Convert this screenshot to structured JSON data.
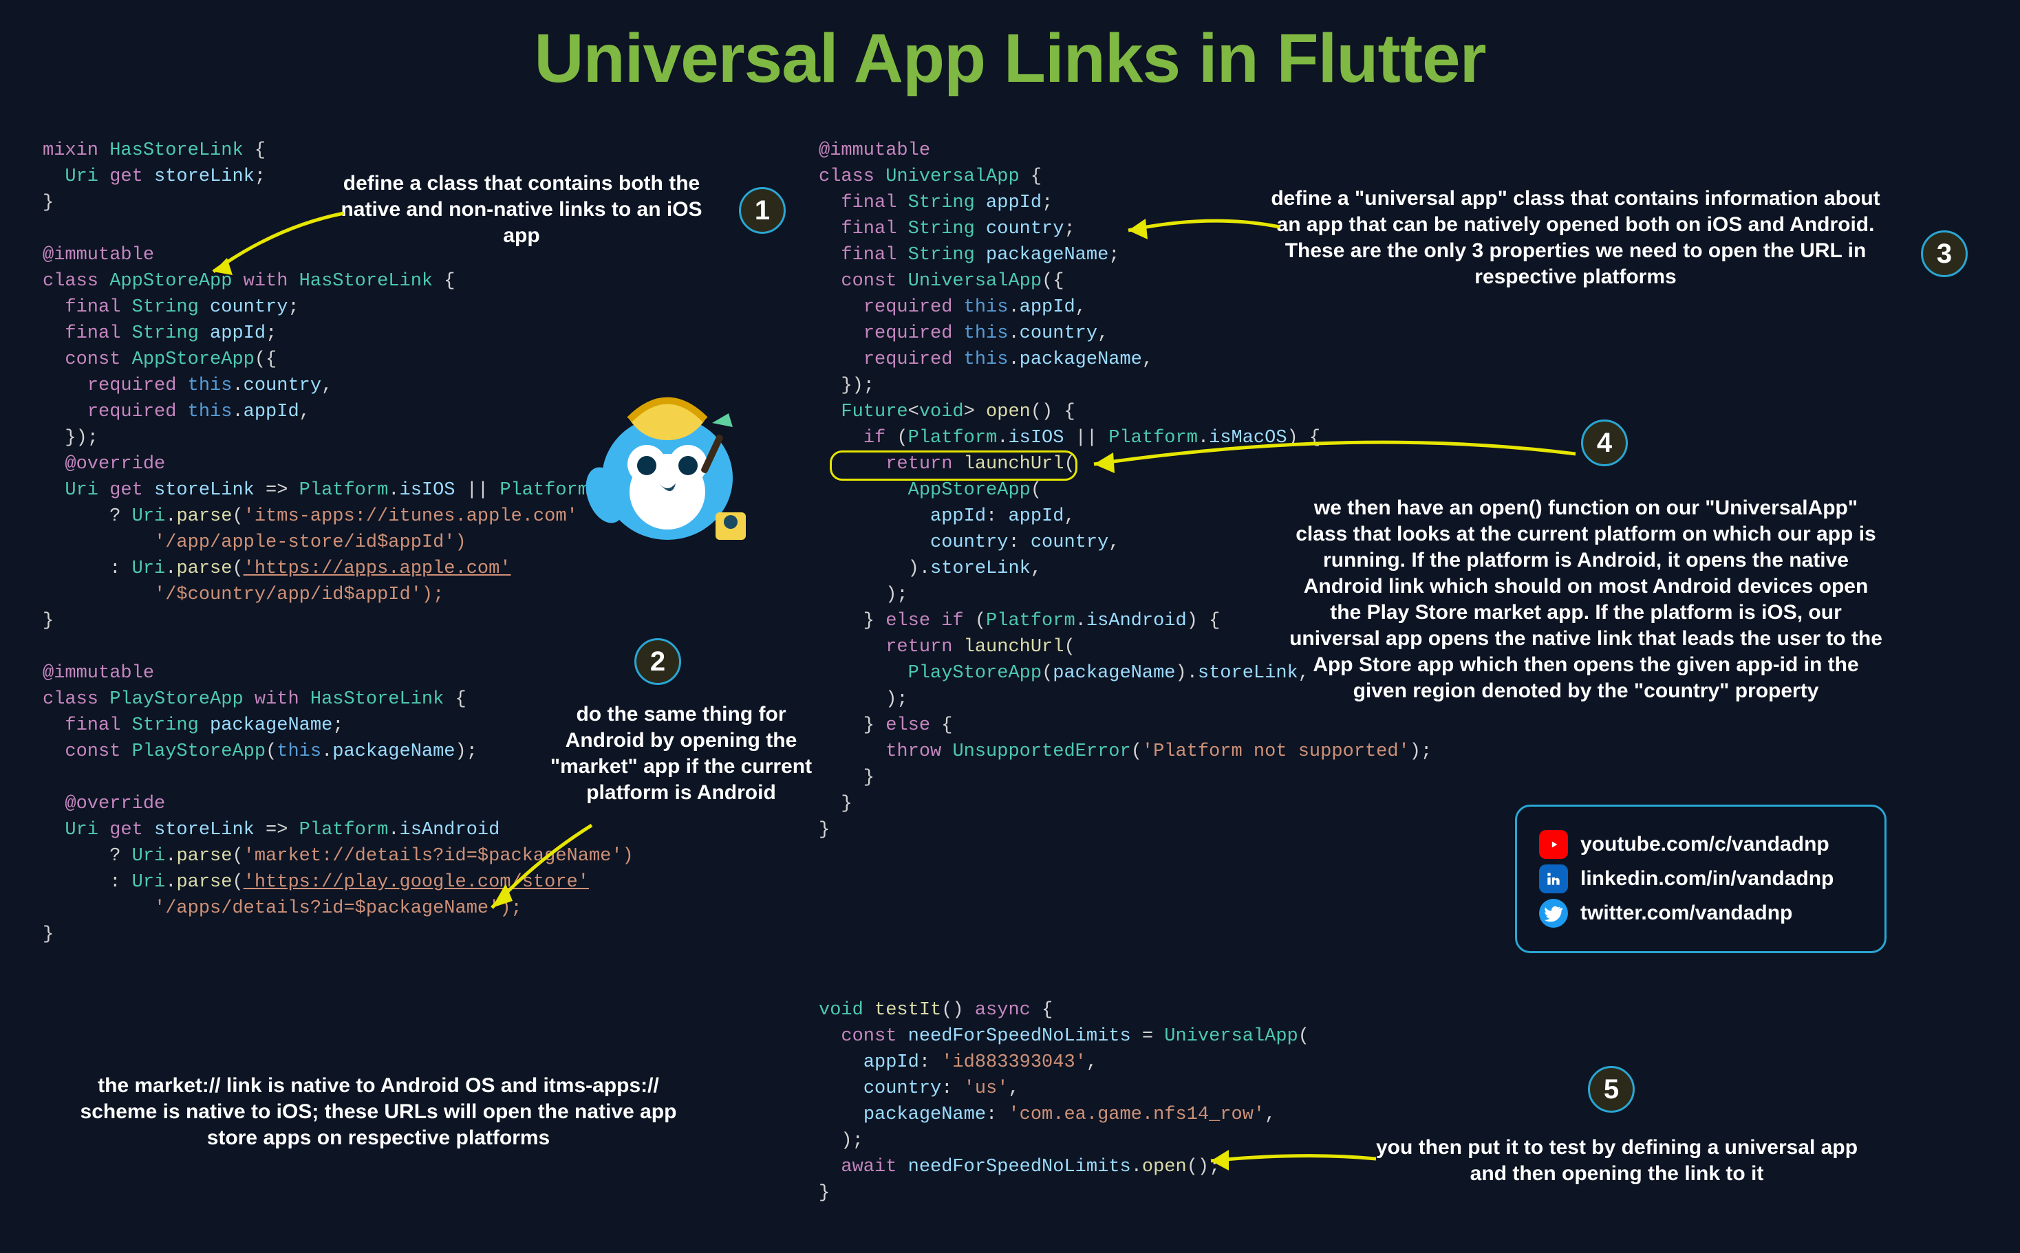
{
  "title": "Universal App Links in Flutter",
  "badges": {
    "b1": "1",
    "b2": "2",
    "b3": "3",
    "b4": "4",
    "b5": "5"
  },
  "annotations": {
    "a1": "define a class that contains both the native and non-native links to an iOS app",
    "a2": "do the same thing for Android by opening the \"market\" app if the current platform is Android",
    "a3": "define a \"universal app\" class that contains information about an app that can be natively opened both on iOS and Android. These are the only 3 properties we need to open the URL in respective platforms",
    "a4": "we then have an open() function on our \"UniversalApp\" class that looks at the current platform on which our app is running. If the platform is Android, it opens the native Android link which should on most Android devices open the Play Store market app. If the platform is iOS, our universal app opens the native link that leads the user to the App Store app which then opens the given app-id in the given region denoted by the \"country\" property",
    "a5": "you then put it to test by defining a universal app and then opening the link to it",
    "a6": "the market:// link is native to Android OS and itms-apps:// scheme is native to iOS; these URLs will open the native app store apps on respective platforms"
  },
  "socials": {
    "youtube": "youtube.com/c/vandadnp",
    "linkedin": "linkedin.com/in/vandadnp",
    "twitter": "twitter.com/vandadnp"
  },
  "code": {
    "hasStoreLink_l1": "mixin",
    "hasStoreLink_name": "HasStoreLink",
    "uri": "Uri",
    "get": "get",
    "storeLinkProp": "storeLink",
    "immutable": "@immutable",
    "classKw": "class",
    "withKw": "with",
    "appStoreApp": "AppStoreApp",
    "finalKw": "final",
    "stringT": "String",
    "countryProp": "country",
    "appIdProp": "appId",
    "constKw": "const",
    "requiredKw": "required",
    "thisKw": "this",
    "override": "@override",
    "platformT": "Platform",
    "isIOS": "isIOS",
    "isMacOS": "isMacOS",
    "isAndroid": "isAndroid",
    "parse": "parse",
    "str_itms": "'itms-apps://itunes.apple.com'",
    "str_itms2": "'/app/apple-store/id$appId')",
    "str_apps": "'https://apps.apple.com'",
    "str_apps2": "'/$country/app/id$appId');",
    "playStoreApp": "PlayStoreApp",
    "packageNameProp": "packageName",
    "str_market": "'market://details?id=$packageName')",
    "str_play": "'https://play.google.com/store'",
    "str_play2": "'/apps/details?id=$packageName');",
    "universalApp": "UniversalApp",
    "futureT": "Future",
    "voidT": "void",
    "open": "open",
    "returnKw": "return",
    "ifKw": "if",
    "elseKw": "else",
    "launchUrl": "launchUrl",
    "throwKw": "throw",
    "unsupportedError": "UnsupportedError",
    "str_unsupported": "'Platform not supported'",
    "testIt": "testIt",
    "asyncKw": "async",
    "needForSpeed": "needForSpeedNoLimits",
    "str_appId": "'id883393043'",
    "str_us": "'us'",
    "str_pkg": "'com.ea.game.nfs14_row'",
    "awaitKw": "await"
  }
}
